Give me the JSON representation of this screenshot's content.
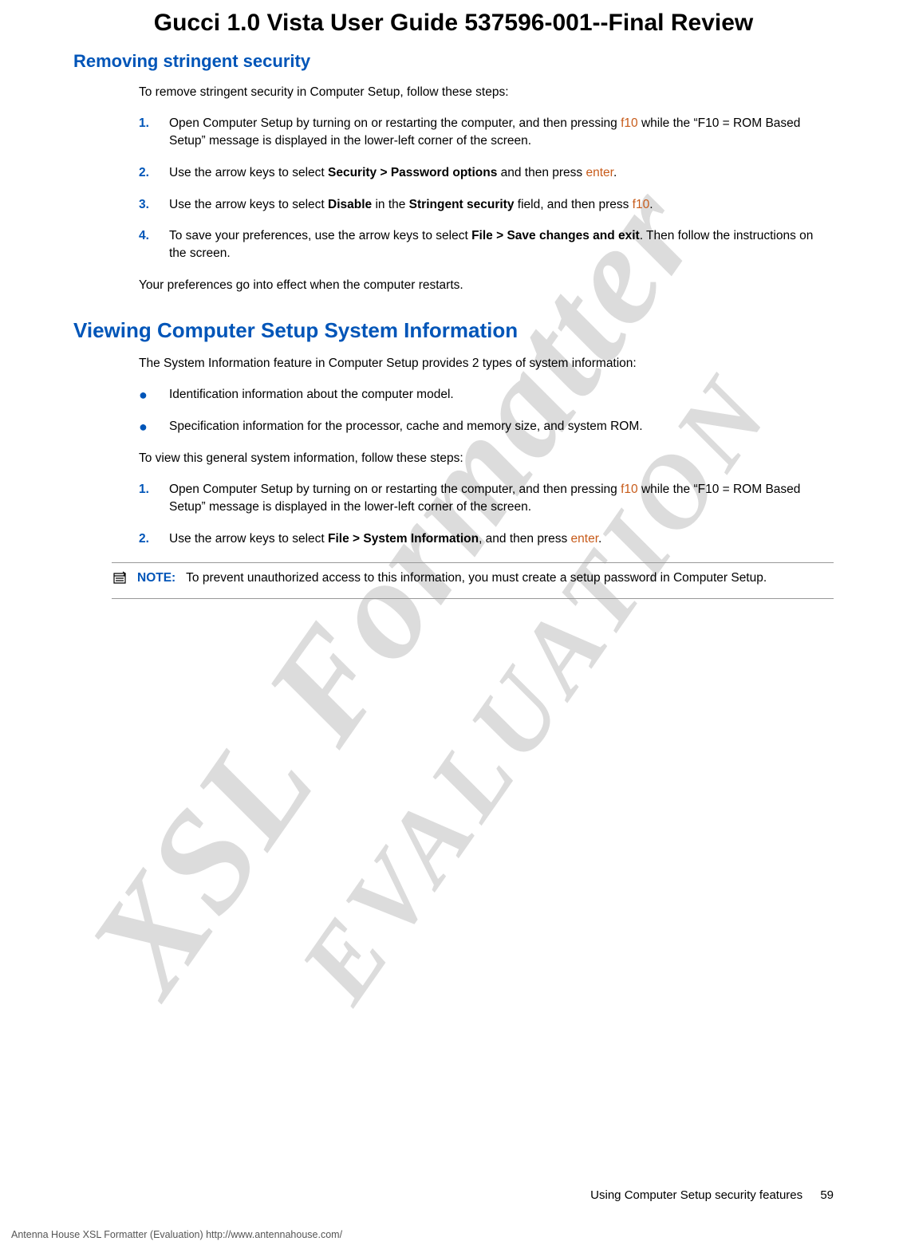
{
  "watermark": {
    "line1": "XSL Formatter",
    "line2": "EVALUATION"
  },
  "page_title": "Gucci 1.0 Vista User Guide 537596-001--Final Review",
  "section1": {
    "heading": "Removing stringent security",
    "intro": "To remove stringent security in Computer Setup, follow these steps:",
    "steps": [
      {
        "num": "1.",
        "pre": "Open Computer Setup by turning on or restarting the computer, and then pressing ",
        "key1": "f10",
        "post": " while the “F10 = ROM Based Setup” message is displayed in the lower-left corner of the screen."
      },
      {
        "num": "2.",
        "pre": "Use the arrow keys to select ",
        "bold1": "Security > Password options",
        "mid": " and then press ",
        "key1": "enter",
        "post": "."
      },
      {
        "num": "3.",
        "pre": "Use the arrow keys to select ",
        "bold1": "Disable",
        "mid": " in the ",
        "bold2": "Stringent security",
        "mid2": " field, and then press ",
        "key1": "f10",
        "post": "."
      },
      {
        "num": "4.",
        "pre": "To save your preferences, use the arrow keys to select ",
        "bold1": "File > Save changes and exit",
        "post": ". Then follow the instructions on the screen."
      }
    ],
    "outro": "Your preferences go into effect when the computer restarts."
  },
  "section2": {
    "heading": "Viewing Computer Setup System Information",
    "intro": "The System Information feature in Computer Setup provides 2 types of system information:",
    "bullets": [
      "Identification information about the computer model.",
      "Specification information for the processor, cache and memory size, and system ROM."
    ],
    "intro2": "To view this general system information, follow these steps:",
    "steps": [
      {
        "num": "1.",
        "pre": "Open Computer Setup by turning on or restarting the computer, and then pressing ",
        "key1": "f10",
        "post": " while the “F10 = ROM Based Setup” message is displayed in the lower-left corner of the screen."
      },
      {
        "num": "2.",
        "pre": "Use the arrow keys to select ",
        "bold1": "File > System Information",
        "mid": ", and then press ",
        "key1": "enter",
        "post": "."
      }
    ],
    "note": {
      "label": "NOTE:",
      "text": "To prevent unauthorized access to this information, you must create a setup password in Computer Setup."
    }
  },
  "footer": {
    "right_text": "Using Computer Setup security features",
    "page_num": "59",
    "left_text": "Antenna House XSL Formatter (Evaluation)  http://www.antennahouse.com/"
  }
}
